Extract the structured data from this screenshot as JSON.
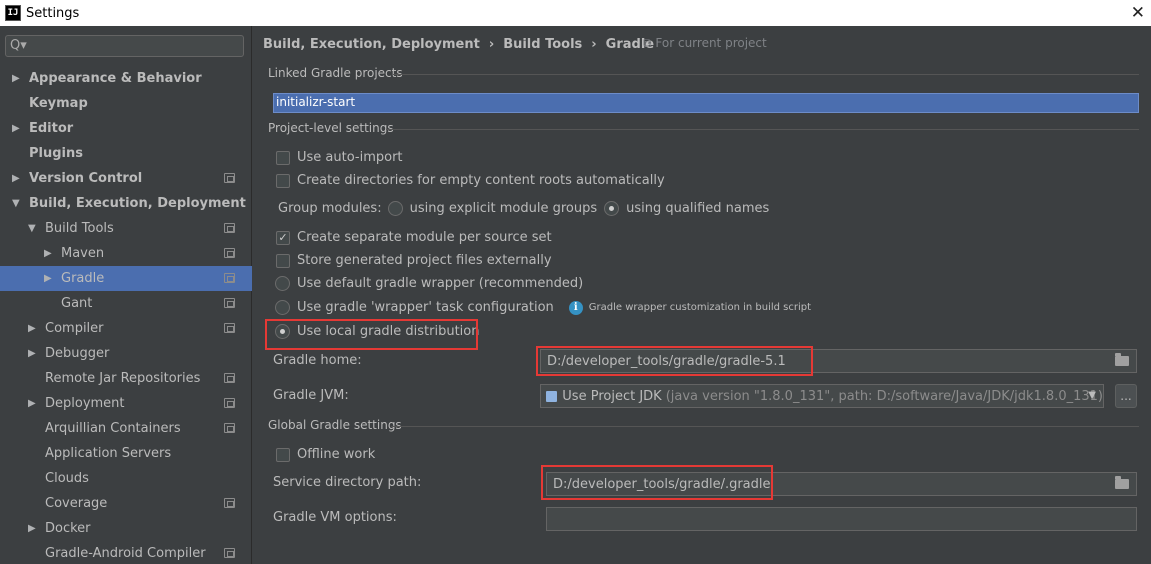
{
  "window": {
    "title": "Settings",
    "app_icon_text": "IJ"
  },
  "search": {
    "placeholder": "Q▾"
  },
  "sidebar": {
    "items": [
      {
        "label": "Appearance & Behavior",
        "bold": true,
        "arrow": "▶",
        "indent": 0
      },
      {
        "label": "Keymap",
        "bold": true,
        "arrow": "",
        "indent": 0
      },
      {
        "label": "Editor",
        "bold": true,
        "arrow": "▶",
        "indent": 0
      },
      {
        "label": "Plugins",
        "bold": true,
        "arrow": "",
        "indent": 0
      },
      {
        "label": "Version Control",
        "bold": true,
        "arrow": "▶",
        "indent": 0,
        "project_icon": true
      },
      {
        "label": "Build, Execution, Deployment",
        "bold": true,
        "arrow": "▼",
        "indent": 0
      },
      {
        "label": "Build Tools",
        "bold": false,
        "arrow": "▼",
        "indent": 1,
        "project_icon": true
      },
      {
        "label": "Maven",
        "bold": false,
        "arrow": "▶",
        "indent": 2,
        "project_icon": true
      },
      {
        "label": "Gradle",
        "bold": false,
        "arrow": "▶",
        "indent": 2,
        "project_icon": true,
        "selected": true
      },
      {
        "label": "Gant",
        "bold": false,
        "arrow": "",
        "indent": 2,
        "project_icon": true
      },
      {
        "label": "Compiler",
        "bold": false,
        "arrow": "▶",
        "indent": 1,
        "project_icon": true
      },
      {
        "label": "Debugger",
        "bold": false,
        "arrow": "▶",
        "indent": 1
      },
      {
        "label": "Remote Jar Repositories",
        "bold": false,
        "arrow": "",
        "indent": 1,
        "project_icon": true
      },
      {
        "label": "Deployment",
        "bold": false,
        "arrow": "▶",
        "indent": 1,
        "project_icon": true
      },
      {
        "label": "Arquillian Containers",
        "bold": false,
        "arrow": "",
        "indent": 1,
        "project_icon": true
      },
      {
        "label": "Application Servers",
        "bold": false,
        "arrow": "",
        "indent": 1
      },
      {
        "label": "Clouds",
        "bold": false,
        "arrow": "",
        "indent": 1
      },
      {
        "label": "Coverage",
        "bold": false,
        "arrow": "",
        "indent": 1,
        "project_icon": true
      },
      {
        "label": "Docker",
        "bold": false,
        "arrow": "▶",
        "indent": 1
      },
      {
        "label": "Gradle-Android Compiler",
        "bold": false,
        "arrow": "",
        "indent": 1,
        "project_icon": true
      }
    ]
  },
  "breadcrumb": {
    "items": [
      "Build, Execution, Deployment",
      "Build Tools",
      "Gradle"
    ],
    "separator": "›",
    "scope": "For current project"
  },
  "sections": {
    "linked": "Linked Gradle projects",
    "project_level": "Project-level settings",
    "global": "Global Gradle settings"
  },
  "linked_projects": [
    "initializr-start"
  ],
  "options": {
    "auto_import": {
      "label": "Use auto-import",
      "checked": false
    },
    "create_dirs": {
      "label": "Create directories for empty content roots automatically",
      "checked": false
    },
    "group_modules": {
      "label": "Group modules:",
      "choices": [
        {
          "label": "using explicit module groups",
          "selected": false
        },
        {
          "label": "using qualified names",
          "selected": true
        }
      ]
    },
    "separate_module": {
      "label": "Create separate module per source set",
      "checked": true
    },
    "store_external": {
      "label": "Store generated project files externally",
      "checked": false
    },
    "dist_default": {
      "label": "Use default gradle wrapper (recommended)",
      "selected": false
    },
    "dist_wrapper": {
      "label": "Use gradle 'wrapper' task configuration",
      "selected": false
    },
    "dist_local": {
      "label": "Use local gradle distribution",
      "selected": true
    },
    "wrapper_hint": "Gradle wrapper customization in build script",
    "offline": {
      "label": "Offline work",
      "checked": false
    }
  },
  "fields": {
    "gradle_home": {
      "label": "Gradle home:",
      "value": "D:/developer_tools/gradle/gradle-5.1"
    },
    "gradle_jvm": {
      "label": "Gradle JVM:",
      "value": "Use Project JDK",
      "detail": "(java version \"1.8.0_131\", path: D:/software/Java/JDK/jdk1.8.0_131)",
      "button": "..."
    },
    "service_dir": {
      "label": "Service directory path:",
      "value": "D:/developer_tools/gradle/.gradle"
    },
    "vm_options": {
      "label": "Gradle VM options:",
      "value": ""
    }
  },
  "colors": {
    "selection": "#4b6eaf",
    "highlight": "#e53935",
    "background": "#3c3f41"
  }
}
